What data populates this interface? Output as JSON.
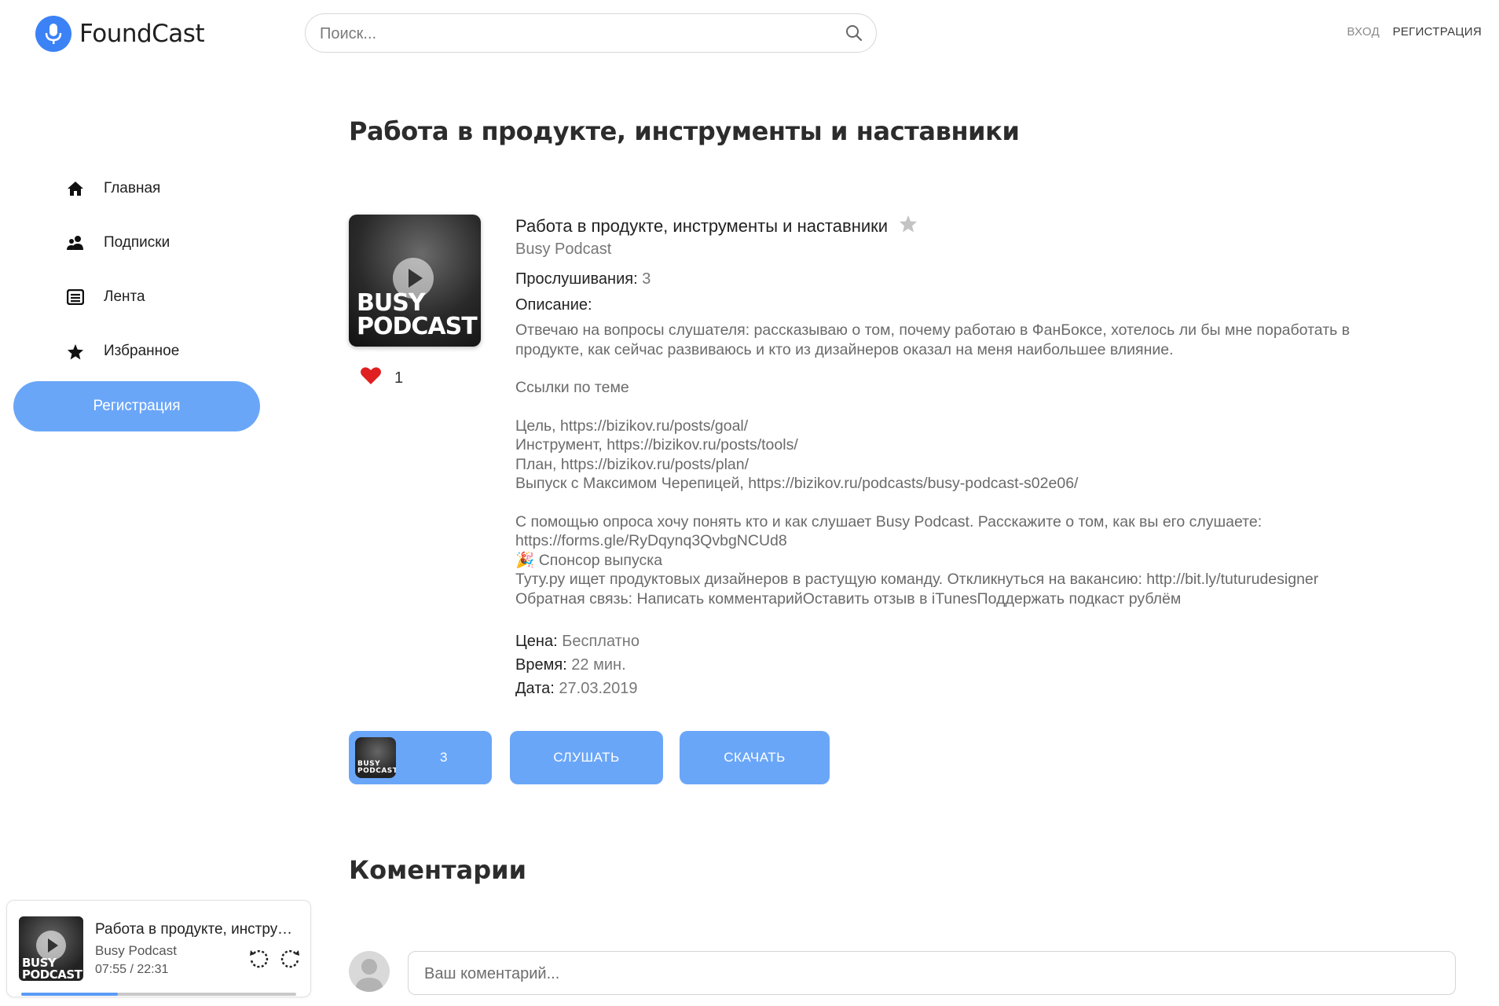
{
  "header": {
    "logo_text": "FoundCast",
    "search_placeholder": "Поиск...",
    "login_label": "ВХОД",
    "register_label": "РЕГИСТРАЦИЯ"
  },
  "sidebar": {
    "items": [
      {
        "label": "Главная",
        "icon": "home-icon"
      },
      {
        "label": "Подписки",
        "icon": "users-icon"
      },
      {
        "label": "Лента",
        "icon": "list-icon"
      },
      {
        "label": "Избранное",
        "icon": "star-icon"
      }
    ],
    "register_button": "Регистрация"
  },
  "page": {
    "title": "Работа в продукте, инструменты и наставники"
  },
  "episode": {
    "cover_text_line1": "BUSY",
    "cover_text_line2": "PODCAST",
    "likes": "1",
    "title": "Работа в продукте, инструменты и наставники",
    "podcast": "Busy Podcast",
    "listens_label": "Прослушивания:",
    "listens_value": "3",
    "description_label": "Описание:",
    "description": {
      "p1": "Отвечаю на вопросы слушателя: рассказываю о том, почему работаю в ФанБоксе, хотелось ли бы мне поработать в продукте, как сейчас развиваюсь и кто из дизайнеров оказал на меня наибольшее влияние.",
      "p2": "Ссылки по теме",
      "l1": "Цель, https://bizikov.ru/posts/goal/",
      "l2": "Инструмент, https://bizikov.ru/posts/tools/",
      "l3": "План, https://bizikov.ru/posts/plan/",
      "l4": "Выпуск с Максимом Черепицей, https://bizikov.ru/podcasts/busy-podcast-s02e06/",
      "p3": "С помощью опроса хочу понять кто и как слушает Busy Podcast. Расскажите о том, как вы его слушаете: https://forms.gle/RyDqynq3QvbgNCUd8",
      "sponsor_emoji": "🎉",
      "sponsor": "Спонсор выпуска",
      "p4": "Туту.ру ищет продуктовых дизайнеров в растущую команду. Откликнуться на вакансию: http://bit.ly/tuturudesigner",
      "p5": "Обратная связь: Написать комментарийОставить отзыв в iTunesПоддержать подкаст рублём"
    },
    "price_label": "Цена:",
    "price_value": "Бесплатно",
    "duration_label": "Время:",
    "duration_value": "22 мин.",
    "date_label": "Дата:",
    "date_value": "27.03.2019"
  },
  "actions": {
    "episodes_count": "3",
    "listen_label": "СЛУШАТЬ",
    "download_label": "СКАЧАТЬ"
  },
  "comments": {
    "title": "Коментарии",
    "input_placeholder": "Ваш коментарий..."
  },
  "player": {
    "title": "Работа в продукте, инструменты и наставники",
    "podcast": "Busy Podcast",
    "time": "07:55 / 22:31",
    "cover_text_line1": "BUSY",
    "cover_text_line2": "PODCAST",
    "progress": 0.35
  },
  "colors": {
    "accent": "#6aa6f8",
    "logo": "#3b82f6",
    "heart": "#e02020"
  }
}
